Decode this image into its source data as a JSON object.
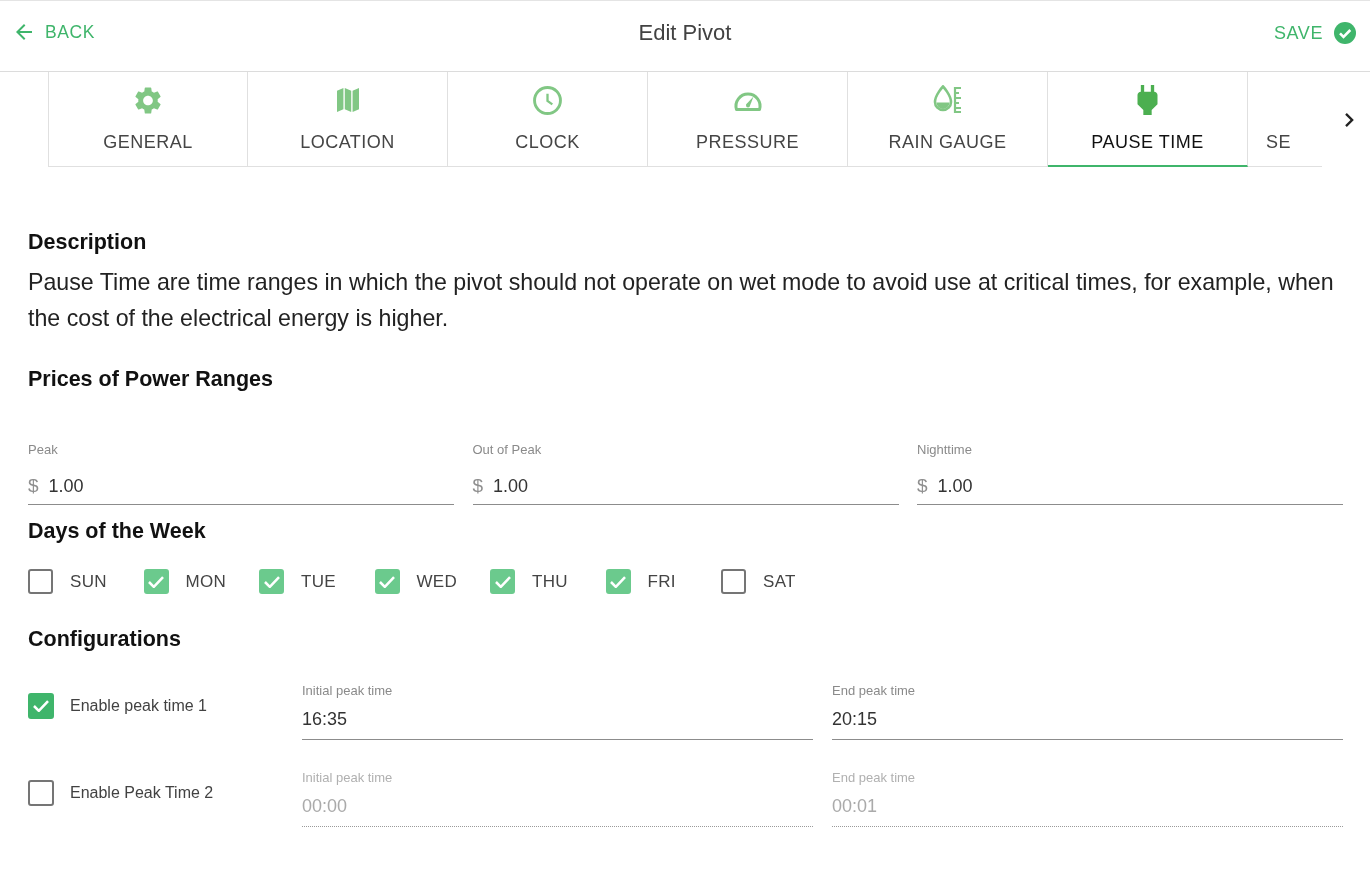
{
  "header": {
    "back": "BACK",
    "title": "Edit Pivot",
    "save": "SAVE"
  },
  "tabs": [
    {
      "label": "GENERAL",
      "selected": false
    },
    {
      "label": "LOCATION",
      "selected": false
    },
    {
      "label": "CLOCK",
      "selected": false
    },
    {
      "label": "PRESSURE",
      "selected": false
    },
    {
      "label": "RAIN GAUGE",
      "selected": false
    },
    {
      "label": "PAUSE TIME",
      "selected": true
    },
    {
      "label": "SE",
      "selected": false
    }
  ],
  "description": {
    "heading": "Description",
    "text": "Pause Time are time ranges in which the pivot should not operate on wet mode to avoid use at critical times, for example, when the cost of the electrical energy is higher."
  },
  "prices": {
    "heading": "Prices of Power Ranges",
    "fields": [
      {
        "label": "Peak",
        "prefix": "$",
        "value": "1.00"
      },
      {
        "label": "Out of Peak",
        "prefix": "$",
        "value": "1.00"
      },
      {
        "label": "Nighttime",
        "prefix": "$",
        "value": "1.00"
      }
    ]
  },
  "days": {
    "heading": "Days of the Week",
    "items": [
      {
        "label": "SUN",
        "checked": false
      },
      {
        "label": "MON",
        "checked": true
      },
      {
        "label": "TUE",
        "checked": true
      },
      {
        "label": "WED",
        "checked": true
      },
      {
        "label": "THU",
        "checked": true
      },
      {
        "label": "FRI",
        "checked": true
      },
      {
        "label": "SAT",
        "checked": false
      }
    ]
  },
  "configurations": {
    "heading": "Configurations",
    "rows": [
      {
        "label": "Enable peak time 1",
        "checked": true,
        "fields": [
          {
            "label": "Initial peak time",
            "value": "16:35",
            "disabled": false
          },
          {
            "label": "End peak time",
            "value": "20:15",
            "disabled": false
          }
        ]
      },
      {
        "label": "Enable Peak Time 2",
        "checked": false,
        "fields": [
          {
            "label": "Initial peak time",
            "value": "00:00",
            "disabled": true
          },
          {
            "label": "End peak time",
            "value": "00:01",
            "disabled": true
          }
        ]
      }
    ]
  }
}
